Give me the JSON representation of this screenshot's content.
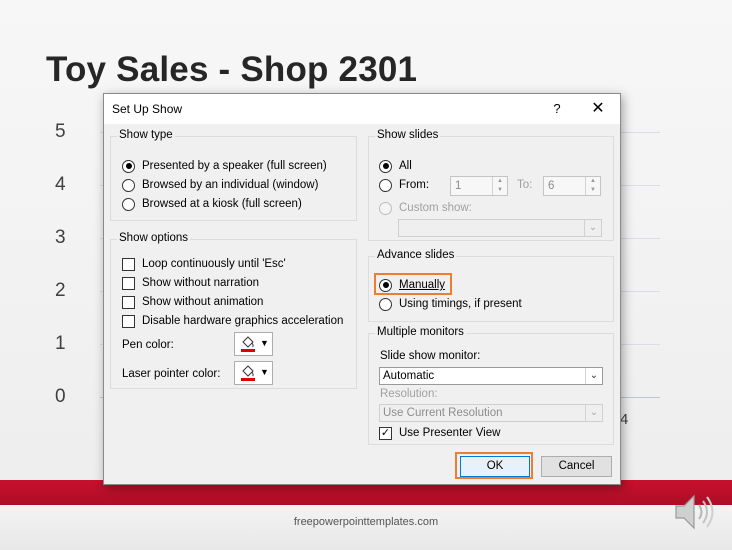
{
  "slide": {
    "title": "Toy Sales - Shop 2301",
    "y_axis_labels": [
      "5",
      "4",
      "3",
      "2",
      "1",
      "0"
    ],
    "x_axis_visible_label": "4",
    "footer": "freepowerpointtemplates.com",
    "speaker_icon": "speaker-icon"
  },
  "dialog": {
    "title": "Set Up Show",
    "help_label": "?",
    "close_label": "✕",
    "show_type": {
      "title": "Show type",
      "options": [
        {
          "label": "Presented by a speaker (full screen)",
          "selected": true
        },
        {
          "label": "Browsed by an individual (window)",
          "selected": false
        },
        {
          "label": "Browsed at a kiosk (full screen)",
          "selected": false
        }
      ]
    },
    "show_options": {
      "title": "Show options",
      "checks": [
        {
          "label": "Loop continuously until 'Esc'",
          "checked": false
        },
        {
          "label": "Show without narration",
          "checked": false
        },
        {
          "label": "Show without animation",
          "checked": false
        },
        {
          "label": "Disable hardware graphics acceleration",
          "checked": false
        }
      ],
      "pen_color_label": "Pen color:",
      "laser_color_label": "Laser pointer color:",
      "pen_color": "#e00000",
      "laser_color": "#e00000"
    },
    "show_slides": {
      "title": "Show slides",
      "all_label": "All",
      "from_label": "From:",
      "from_value": "1",
      "to_label": "To:",
      "to_value": "6",
      "custom_label": "Custom show:",
      "custom_value": ""
    },
    "advance_slides": {
      "title": "Advance slides",
      "manually_label": "Manually",
      "timings_label": "Using timings, if present"
    },
    "monitors": {
      "title": "Multiple monitors",
      "monitor_label": "Slide show monitor:",
      "monitor_value": "Automatic",
      "resolution_label": "Resolution:",
      "resolution_value": "Use Current Resolution",
      "presenter_view_label": "Use Presenter View",
      "presenter_view_checked": true
    },
    "ok_label": "OK",
    "cancel_label": "Cancel",
    "highlight_color": "#ed7d31"
  }
}
